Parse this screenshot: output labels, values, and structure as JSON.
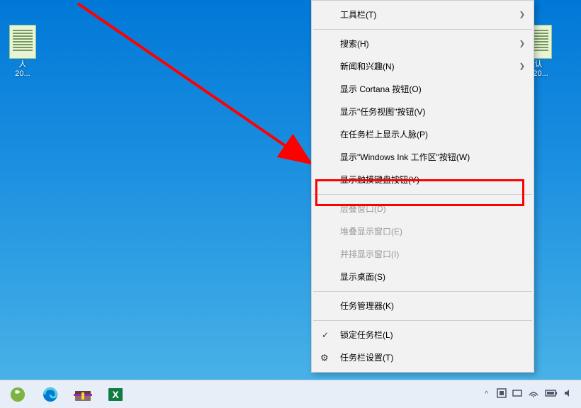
{
  "desktop": {
    "icons": [
      {
        "label": "人",
        "line2": "20..."
      },
      {
        "label": "认",
        "line2": "220..."
      }
    ]
  },
  "context_menu": {
    "items": [
      {
        "label": "工具栏(T)",
        "has_arrow": true,
        "enabled": true
      },
      {
        "label": "搜索(H)",
        "has_arrow": true,
        "enabled": true
      },
      {
        "label": "新闻和兴趣(N)",
        "has_arrow": true,
        "enabled": true
      },
      {
        "label": "显示 Cortana 按钮(O)",
        "enabled": true
      },
      {
        "label": "显示\"任务视图\"按钮(V)",
        "enabled": true
      },
      {
        "label": "在任务栏上显示人脉(P)",
        "enabled": true
      },
      {
        "label": "显示\"Windows Ink 工作区\"按钮(W)",
        "enabled": true
      },
      {
        "label": "显示触摸键盘按钮(Y)",
        "enabled": true,
        "highlighted": true
      },
      {
        "label": "层叠窗口(D)",
        "enabled": false
      },
      {
        "label": "堆叠显示窗口(E)",
        "enabled": false
      },
      {
        "label": "并排显示窗口(I)",
        "enabled": false
      },
      {
        "label": "显示桌面(S)",
        "enabled": true
      },
      {
        "label": "任务管理器(K)",
        "enabled": true
      },
      {
        "label": "锁定任务栏(L)",
        "enabled": true,
        "checked": true
      },
      {
        "label": "任务栏设置(T)",
        "enabled": true,
        "has_gear": true
      }
    ]
  },
  "taskbar": {
    "tray": {
      "caret": "^"
    }
  },
  "annotation": {
    "arrow_color": "#ff0000"
  }
}
